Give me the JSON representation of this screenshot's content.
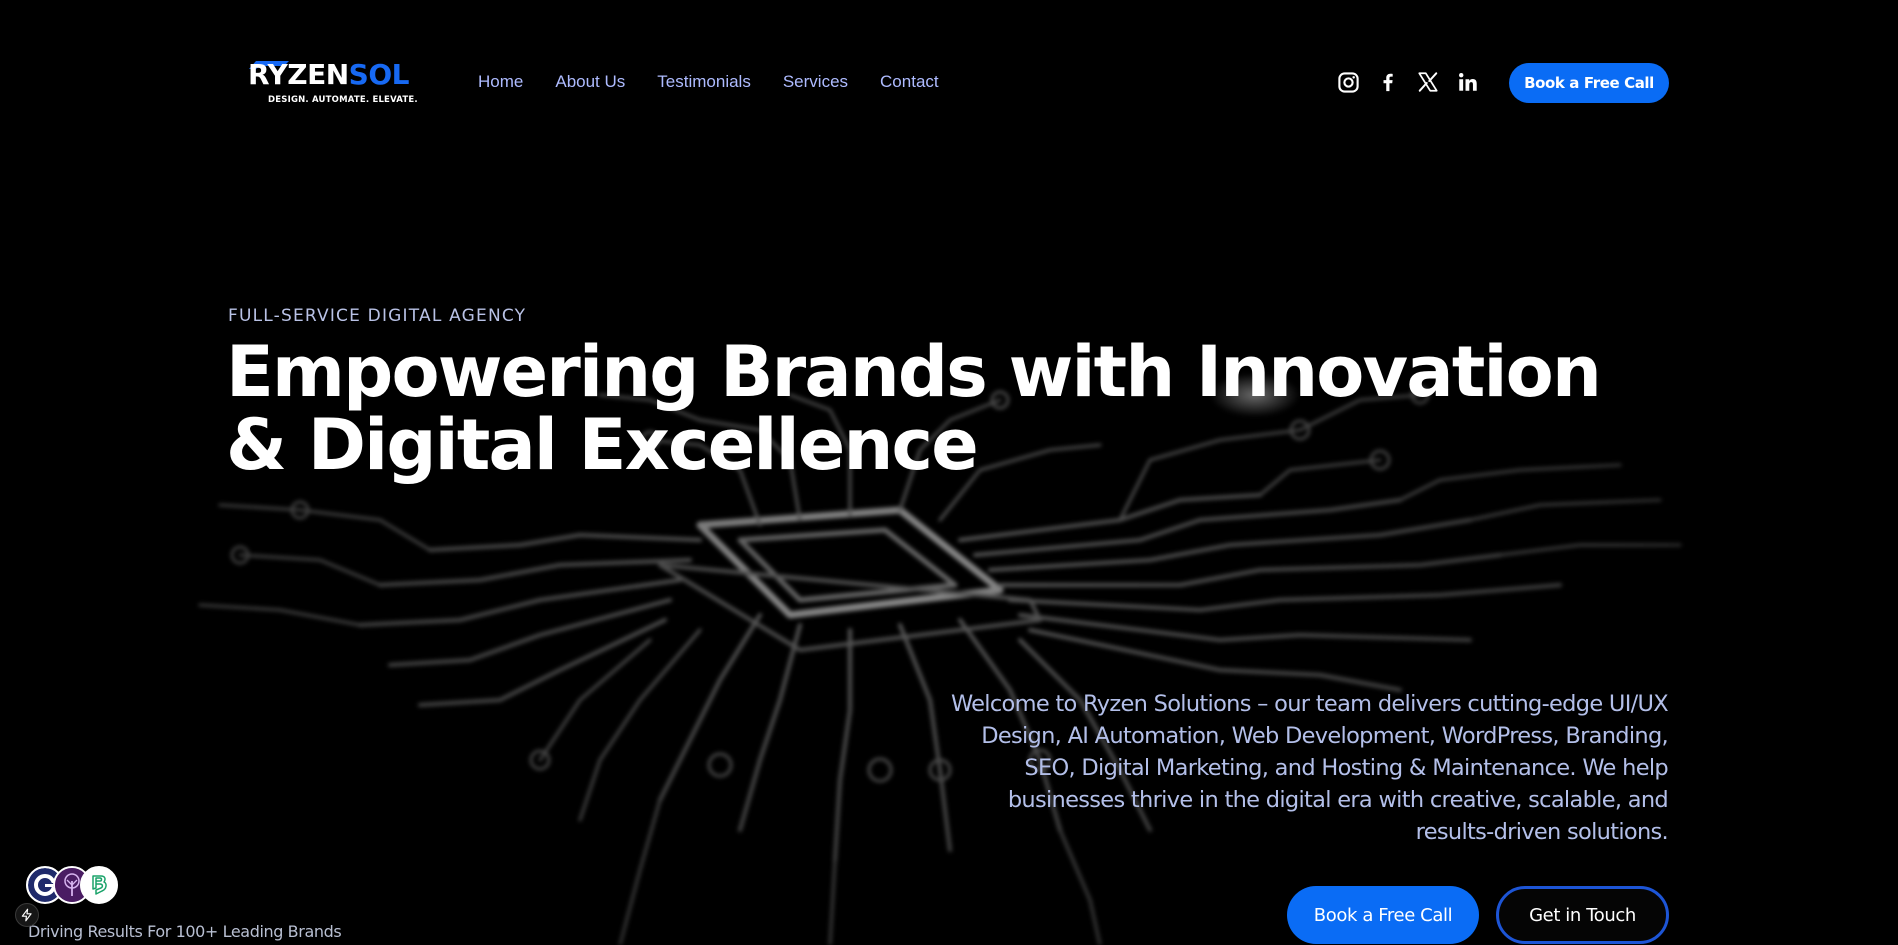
{
  "header": {
    "logo": {
      "first_letter": "R",
      "word": "YZEN",
      "accent_word": "SOL",
      "tagline": "DESIGN. AUTOMATE. ELEVATE."
    },
    "nav": [
      {
        "label": "Home"
      },
      {
        "label": "About Us"
      },
      {
        "label": "Testimonials"
      },
      {
        "label": "Services"
      },
      {
        "label": "Contact"
      }
    ],
    "socials": [
      {
        "icon": "instagram-icon"
      },
      {
        "icon": "facebook-icon"
      },
      {
        "icon": "x-icon"
      },
      {
        "icon": "linkedin-icon"
      }
    ],
    "cta_label": "Book a Free Call"
  },
  "hero": {
    "eyebrow": "FULL-SERVICE DIGITAL AGENCY",
    "headline_line1": "Empowering Brands with Innovation",
    "headline_line2": "& Digital Excellence",
    "intro": "Welcome to Ryzen Solutions – our team delivers cutting-edge UI/UX Design, AI Automation, Web Development, WordPress, Branding, SEO, Digital Marketing, and Hosting & Maintenance. We help businesses thrive in the digital era with creative, scalable, and results-driven solutions.",
    "primary_cta": "Book a Free Call",
    "secondary_cta": "Get in Touch"
  },
  "brands": {
    "caption": "Driving Results For 100+ Leading Brands",
    "avatars": [
      "brand-logo-g",
      "brand-logo-tree",
      "brand-logo-b"
    ]
  },
  "colors": {
    "background": "#000000",
    "accent": "#0a6cf5",
    "nav_text": "#aebbff",
    "body_text": "#b3bfe9",
    "logo_blue": "#1769f3"
  },
  "icons": {
    "badge": "lightning-bolt-icon",
    "background_art": "circuit-board-chip"
  }
}
